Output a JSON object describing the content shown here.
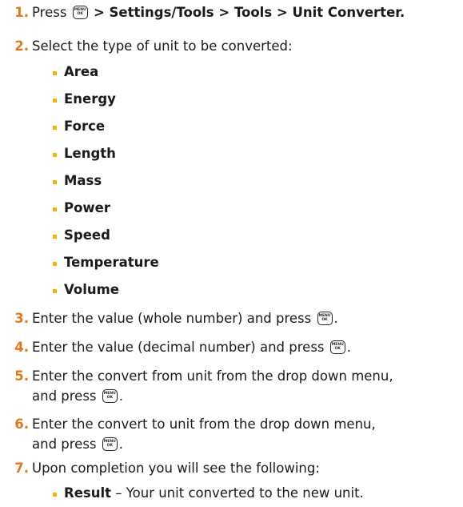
{
  "key": {
    "top": "MENU",
    "bottom": "OK"
  },
  "steps": [
    {
      "num": "1",
      "pre": "Press",
      "path": "> Settings/Tools > Tools > Unit Converter."
    },
    {
      "num": "2",
      "text": "Select the type of unit to be converted:"
    },
    {
      "num": "3",
      "text": "Enter the value (whole number) and press",
      "post": "."
    },
    {
      "num": "4",
      "text": "Enter the value (decimal number) and press",
      "post": "."
    },
    {
      "num": "5",
      "line1": "Enter the convert from unit from the drop down menu,",
      "line2": "and press",
      "post": "."
    },
    {
      "num": "6",
      "line1": "Enter the convert to unit from the drop down menu,",
      "line2": "and press",
      "post": "."
    },
    {
      "num": "7",
      "text": "Upon completion you will see the following:"
    }
  ],
  "unit_types": [
    "Area",
    "Energy",
    "Force",
    "Length",
    "Mass",
    "Power",
    "Speed",
    "Temperature",
    "Volume"
  ],
  "result": {
    "label": "Result",
    "desc": " – Your unit converted to the new unit."
  }
}
